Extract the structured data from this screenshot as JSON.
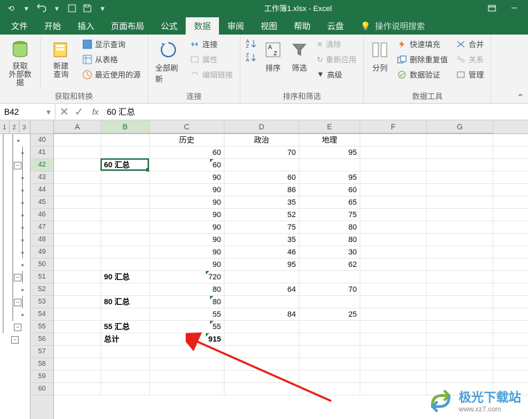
{
  "title": "工作簿1.xlsx - Excel",
  "tabs": {
    "file": "文件",
    "home": "开始",
    "insert": "插入",
    "layout": "页面布局",
    "formulas": "公式",
    "data": "数据",
    "review": "审阅",
    "view": "视图",
    "help": "帮助",
    "cloud": "云盘",
    "tellme": "操作说明搜索"
  },
  "ribbon": {
    "group1_label": "获取和转换",
    "get_data": "获取\n外部数据",
    "new_query": "新建\n查询",
    "show_query": "显示查询",
    "from_table": "从表格",
    "recent_src": "最近使用的源",
    "group2_label": "连接",
    "refresh_all": "全部刷新",
    "connections": "连接",
    "properties": "属性",
    "edit_links": "编辑链接",
    "group3_label": "排序和筛选",
    "sort": "排序",
    "filter": "筛选",
    "clear": "清除",
    "reapply": "重新应用",
    "advanced": "高级",
    "group4_label": "数据工具",
    "text_cols": "分列",
    "flash_fill": "快速填充",
    "remove_dup": "删除重复值",
    "data_valid": "数据验证",
    "consolidate": "合并",
    "relations": "关系",
    "manage": "管理"
  },
  "namebox": "B42",
  "formula": "60 汇总",
  "outline_levels": [
    "1",
    "2",
    "3"
  ],
  "columns": [
    "A",
    "B",
    "C",
    "D",
    "E",
    "F",
    "G"
  ],
  "col_headers": {
    "C": "历史",
    "D": "政治",
    "E": "地理"
  },
  "rows": [
    {
      "n": 40,
      "ol": "dot2"
    },
    {
      "n": 41,
      "ol": "dot3",
      "C": 60,
      "D": 70,
      "E": 95
    },
    {
      "n": 42,
      "ol": "box2",
      "B": "60 汇总",
      "C": 60,
      "sel": true,
      "tri": true
    },
    {
      "n": 43,
      "ol": "dot3",
      "C": 90,
      "D": 60,
      "E": 95
    },
    {
      "n": 44,
      "ol": "dot3",
      "C": 90,
      "D": 86,
      "E": 60
    },
    {
      "n": 45,
      "ol": "dot3",
      "C": 90,
      "D": 35,
      "E": 65
    },
    {
      "n": 46,
      "ol": "dot3",
      "C": 90,
      "D": 52,
      "E": 75
    },
    {
      "n": 47,
      "ol": "dot3",
      "C": 90,
      "D": 75,
      "E": 80
    },
    {
      "n": 48,
      "ol": "dot3",
      "C": 90,
      "D": 35,
      "E": 80
    },
    {
      "n": 49,
      "ol": "dot3",
      "C": 90,
      "D": 46,
      "E": 30
    },
    {
      "n": 50,
      "ol": "dot3",
      "C": 90,
      "D": 95,
      "E": 62
    },
    {
      "n": 51,
      "ol": "box2",
      "B": "90 汇总",
      "C": 720,
      "tri": true
    },
    {
      "n": 52,
      "ol": "dot3",
      "C": 80,
      "D": 64,
      "E": 70
    },
    {
      "n": 53,
      "ol": "box2",
      "B": "80 汇总",
      "C": 80,
      "tri": true
    },
    {
      "n": 54,
      "ol": "dot3",
      "C": 55,
      "D": 84,
      "E": 25
    },
    {
      "n": 55,
      "ol": "box2",
      "B": "55 汇总",
      "C": 55,
      "tri": true
    },
    {
      "n": 56,
      "ol": "box1",
      "B": "总计",
      "C": 915,
      "tri": true,
      "bold": true
    },
    {
      "n": 57
    },
    {
      "n": 58
    },
    {
      "n": 59
    },
    {
      "n": 60
    }
  ],
  "watermark": {
    "main": "极光下载站",
    "sub": "www.xz7.com"
  }
}
